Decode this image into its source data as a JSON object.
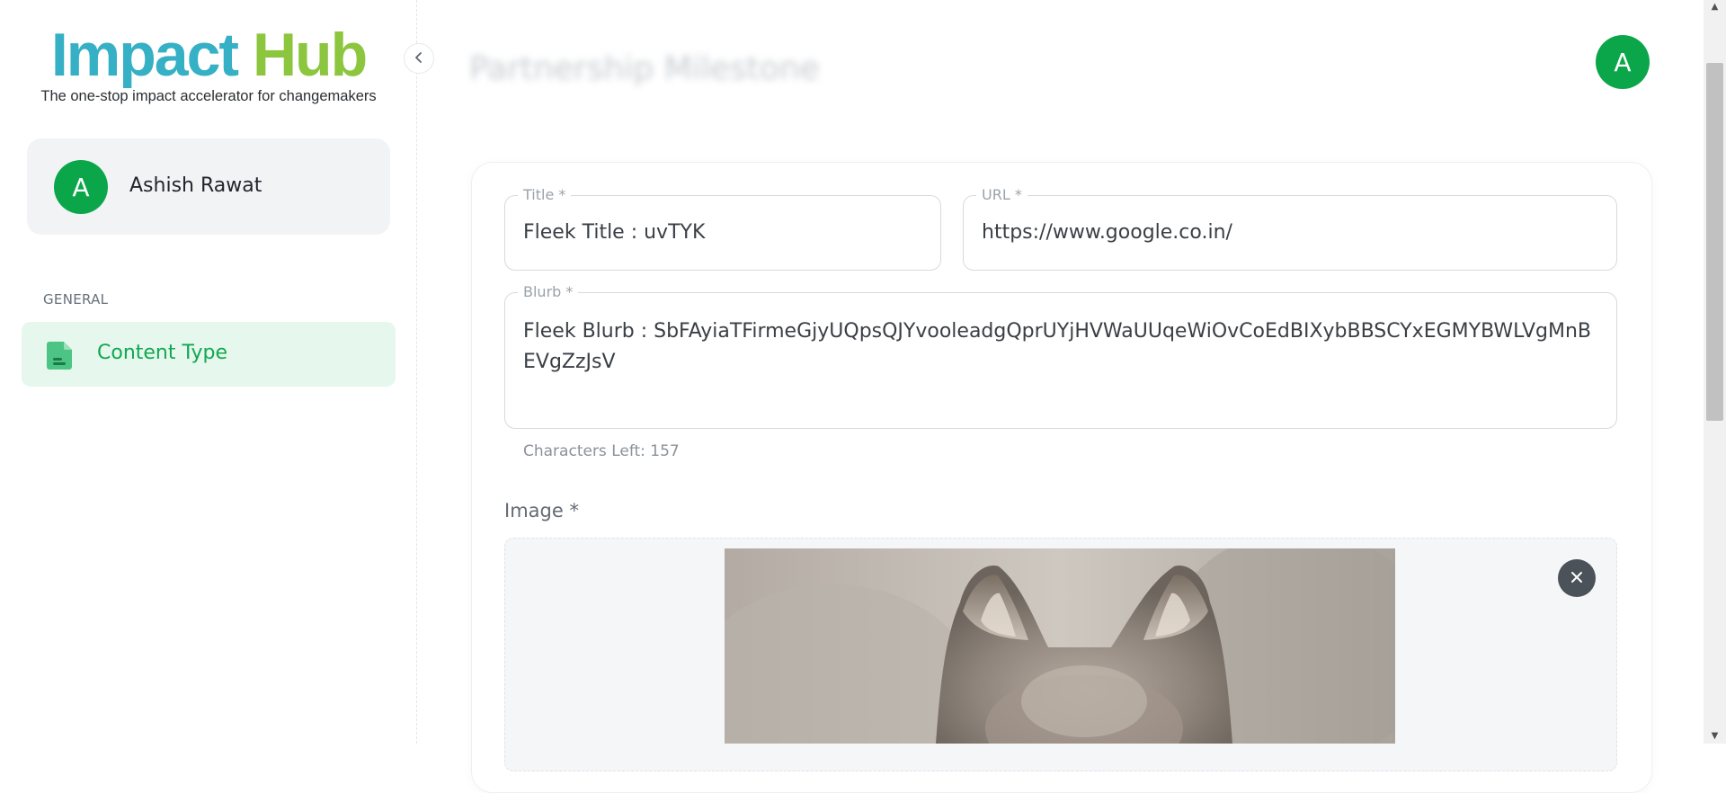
{
  "sidebar": {
    "logo_word1": "Impact",
    "logo_word2": "Hub",
    "tagline": "The one-stop impact accelerator for changemakers",
    "collapse_icon": "chevron-left",
    "user": {
      "initial": "A",
      "name": "Ashish Rawat"
    },
    "section_label": "GENERAL",
    "nav_items": [
      {
        "label": "Content Type",
        "icon": "document-icon"
      }
    ]
  },
  "header": {
    "title": "Partnership Milestone",
    "avatar_initial": "A"
  },
  "form": {
    "title": {
      "label": "Title *",
      "value": "Fleek Title : uvTYK"
    },
    "url": {
      "label": "URL *",
      "value": "https://www.google.co.in/"
    },
    "blurb": {
      "label": "Blurb *",
      "value": "Fleek Blurb : SbFAyiaTFirmeGjyUQpsQJYvooleadgQprUYjHVWaUUqeWiOvCoEdBIXybBBSCYxEGMYBWLVgMnBEVgZzJsV"
    },
    "chars_left": "Characters Left: 157",
    "image_label": "Image *",
    "remove_icon": "close-icon"
  },
  "colors": {
    "brand_teal": "#35b0c4",
    "brand_green": "#8cc63e",
    "accent_green": "#0ba64a",
    "nav_active_bg": "#e6f7ee"
  }
}
